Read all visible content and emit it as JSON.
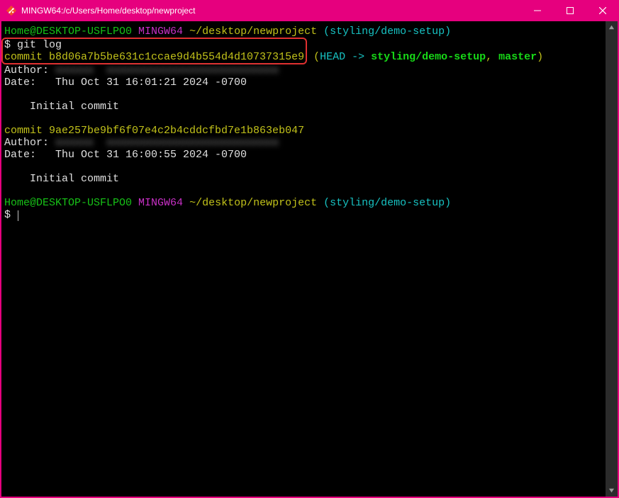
{
  "titlebar": {
    "title": "MINGW64:/c/Users/Home/desktop/newproject"
  },
  "prompt": {
    "userhost": "Home@DESKTOP-USFLPO0",
    "env": "MINGW64",
    "path": "~/desktop/newproject",
    "branch_open": "(",
    "branch": "styling/demo-setup",
    "branch_close": ")",
    "symbol": "$"
  },
  "cmd": {
    "gitlog": "git log"
  },
  "commits": [
    {
      "line": "commit b8d06a7b5be631c1ccae9d4b554d4d10737315e9",
      "ref_open": " (",
      "head": "HEAD -> ",
      "head_branch": "styling/demo-setup",
      "sep": ", ",
      "master": "master",
      "ref_close": ")",
      "author_label": "Author:",
      "author_value_blur": "xxxxxx  xxxxxxxxxxxxxxxxxxxxxxxxxxx",
      "date_label": "Date:   ",
      "date_value": "Thu Oct 31 16:01:21 2024 -0700",
      "message": "    Initial commit"
    },
    {
      "line": "commit 9ae257be9bf6f07e4c2b4cddcfbd7e1b863eb047",
      "author_label": "Author:",
      "author_value_blur": "xxxxxx  xxxxxxxxxxxxxxxxxxxxxxxxxxx",
      "date_label": "Date:   ",
      "date_value": "Thu Oct 31 16:00:55 2024 -0700",
      "message": "    Initial commit"
    }
  ]
}
